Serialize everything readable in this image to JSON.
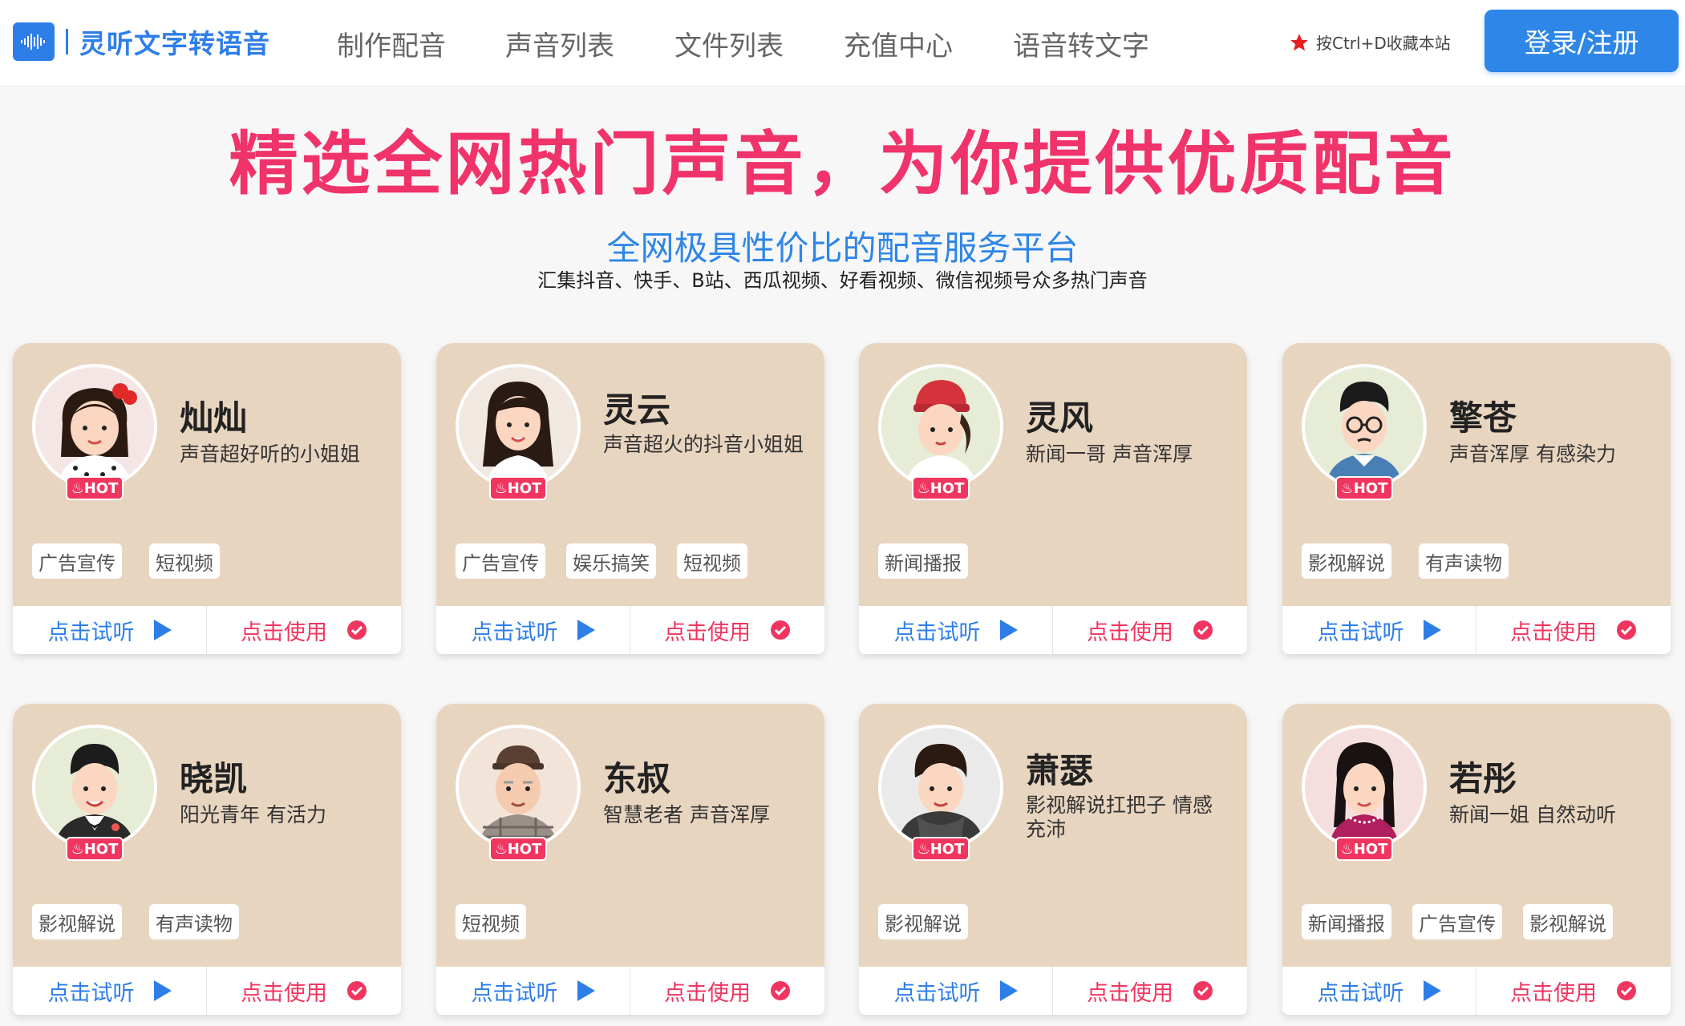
{
  "header": {
    "logo_text": "灵听文字转语音",
    "nav": [
      "制作配音",
      "声音列表",
      "文件列表",
      "充值中心",
      "语音转文字"
    ],
    "favorite_text": "按Ctrl+D收藏本站",
    "login_label": "登录/注册"
  },
  "hero": {
    "title": "精选全网热门声音，为你提供优质配音",
    "subtitle": "全网极具性价比的配音服务平台",
    "description": "汇集抖音、快手、B站、西瓜视频、好看视频、微信视频号众多热门声音"
  },
  "card_common": {
    "hot_label": "HOT",
    "listen_label": "点击试听",
    "use_label": "点击使用"
  },
  "voices": [
    {
      "name": "灿灿",
      "desc": "声音超好听的小姐姐",
      "tags": [
        "广告宣传",
        "短视频"
      ]
    },
    {
      "name": "灵云",
      "desc": "声音超火的抖音小姐姐",
      "tags": [
        "广告宣传",
        "娱乐搞笑",
        "短视频"
      ]
    },
    {
      "name": "灵风",
      "desc": "新闻一哥 声音浑厚",
      "tags": [
        "新闻播报"
      ]
    },
    {
      "name": "擎苍",
      "desc": "声音浑厚 有感染力",
      "tags": [
        "影视解说",
        "有声读物"
      ]
    },
    {
      "name": "晓凯",
      "desc": "阳光青年 有活力",
      "tags": [
        "影视解说",
        "有声读物"
      ]
    },
    {
      "name": "东叔",
      "desc": "智慧老者 声音浑厚",
      "tags": [
        "短视频"
      ]
    },
    {
      "name": "萧瑟",
      "desc": "影视解说扛把子 情感充沛",
      "tags": [
        "影视解说"
      ]
    },
    {
      "name": "若彤",
      "desc": "新闻一姐 自然动听",
      "tags": [
        "新闻播报",
        "广告宣传",
        "影视解说"
      ]
    }
  ],
  "colors": {
    "primary": "#2e86e8",
    "accent": "#f0336a",
    "card_bg": "#e8d5c0"
  }
}
